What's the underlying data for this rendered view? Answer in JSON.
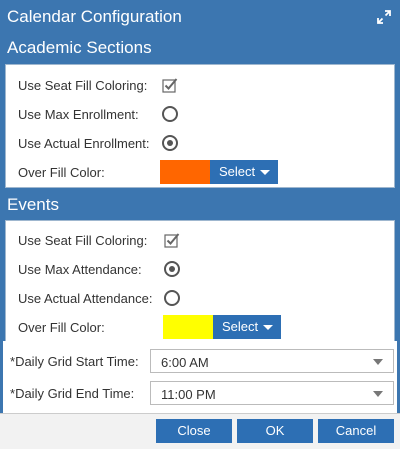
{
  "dialog": {
    "title": "Calendar Configuration",
    "expand_icon": "expand-icon"
  },
  "academic_sections": {
    "header": "Academic Sections",
    "seat_fill_label": "Use Seat Fill Coloring:",
    "seat_fill_checked": true,
    "max_enrollment_label": "Use Max Enrollment:",
    "max_enrollment_selected": false,
    "actual_enrollment_label": "Use Actual Enrollment:",
    "actual_enrollment_selected": true,
    "over_fill_label": "Over Fill Color:",
    "over_fill_color": "#ff6600",
    "select_label": "Select"
  },
  "events": {
    "header": "Events",
    "seat_fill_label": "Use Seat Fill Coloring:",
    "seat_fill_checked": true,
    "max_attendance_label": "Use Max Attendance:",
    "max_attendance_selected": true,
    "actual_attendance_label": "Use Actual Attendance:",
    "actual_attendance_selected": false,
    "over_fill_label": "Over Fill Color:",
    "over_fill_color": "#ffff00",
    "select_label": "Select"
  },
  "grid": {
    "required_marker": "*",
    "start_label": "Daily Grid Start Time:",
    "start_value": "6:00 AM",
    "end_label": "Daily Grid End Time:",
    "end_value": "11:00 PM"
  },
  "footer": {
    "close_label": "Close",
    "ok_label": "OK",
    "cancel_label": "Cancel"
  },
  "colors": {
    "accent": "#3c76b0",
    "button": "#2d6fb4"
  }
}
